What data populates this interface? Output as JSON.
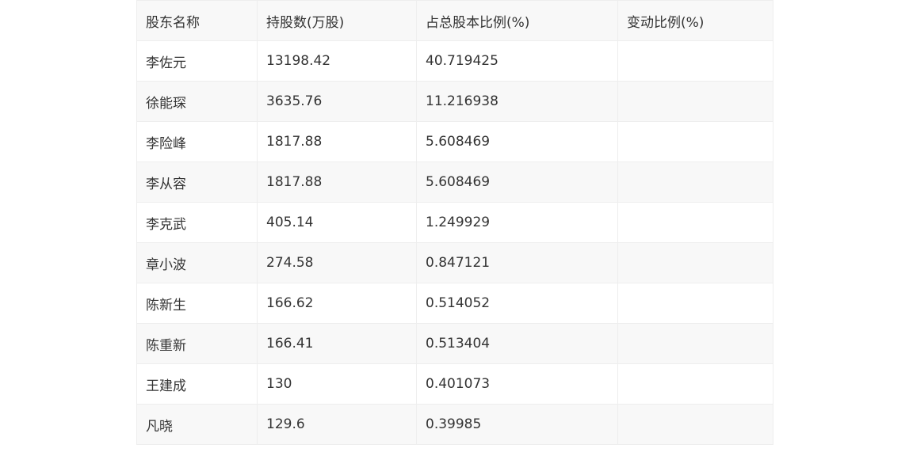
{
  "table": {
    "headers": [
      "股东名称",
      "持股数(万股)",
      "占总股本比例(%)",
      "变动比例(%)"
    ],
    "rows": [
      {
        "name": "李佐元",
        "shares": "13198.42",
        "ratio": "40.719425",
        "change": ""
      },
      {
        "name": "徐能琛",
        "shares": "3635.76",
        "ratio": "11.216938",
        "change": ""
      },
      {
        "name": "李险峰",
        "shares": "1817.88",
        "ratio": "5.608469",
        "change": ""
      },
      {
        "name": "李从容",
        "shares": "1817.88",
        "ratio": "5.608469",
        "change": ""
      },
      {
        "name": "李克武",
        "shares": "405.14",
        "ratio": "1.249929",
        "change": ""
      },
      {
        "name": "章小波",
        "shares": "274.58",
        "ratio": "0.847121",
        "change": ""
      },
      {
        "name": "陈新生",
        "shares": "166.62",
        "ratio": "0.514052",
        "change": ""
      },
      {
        "name": "陈重新",
        "shares": "166.41",
        "ratio": "0.513404",
        "change": ""
      },
      {
        "name": "王建成",
        "shares": "130",
        "ratio": "0.401073",
        "change": ""
      },
      {
        "name": "凡晓",
        "shares": "129.6",
        "ratio": "0.39985",
        "change": ""
      }
    ]
  }
}
